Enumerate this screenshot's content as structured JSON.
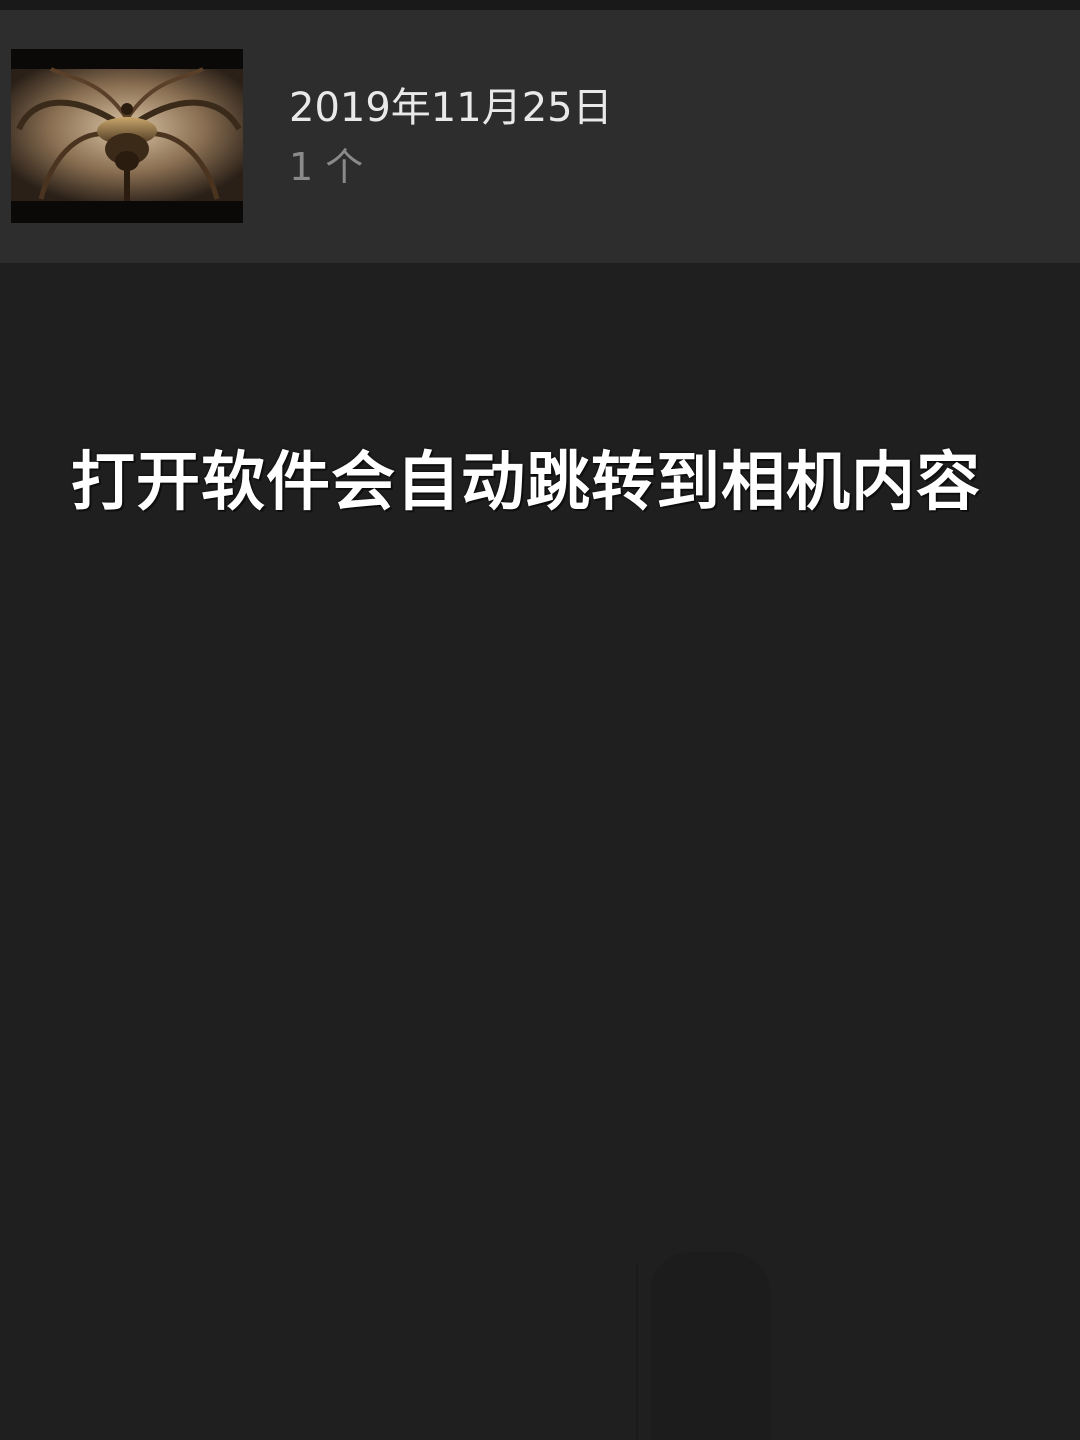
{
  "album": {
    "date": "2019年11月25日",
    "count": "1 个",
    "thumbnail_icon": "chandelier-photo"
  },
  "overlay": {
    "caption": "打开软件会自动跳转到相机内容"
  }
}
